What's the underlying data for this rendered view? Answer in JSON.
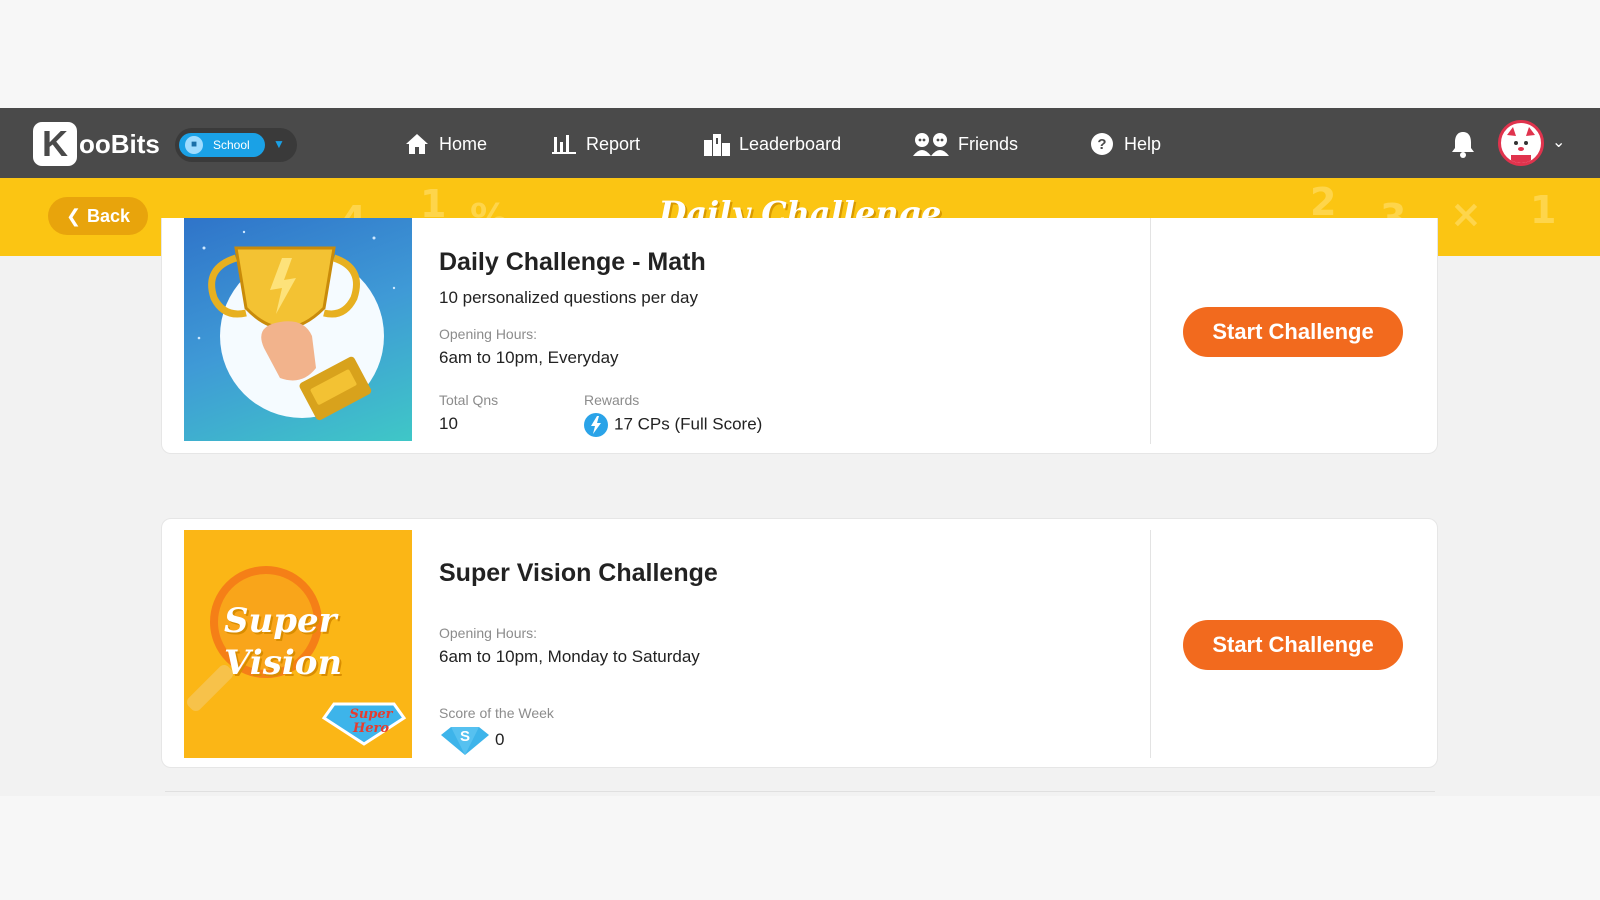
{
  "nav": {
    "logo_k": "K",
    "logo_text": "ooBits",
    "school_label": "School",
    "items": [
      {
        "label": "Home",
        "icon": "home-icon"
      },
      {
        "label": "Report",
        "icon": "bar-chart-icon"
      },
      {
        "label": "Leaderboard",
        "icon": "leaderboard-icon"
      },
      {
        "label": "Friends",
        "icon": "friends-icon"
      },
      {
        "label": "Help",
        "icon": "help-icon"
      }
    ]
  },
  "banner": {
    "back_label": "Back",
    "title": "Daily Challenge"
  },
  "challenges": [
    {
      "title": "Daily Challenge - Math",
      "subtitle": "10 personalized questions per day",
      "hours_label": "Opening Hours:",
      "hours": "6am to 10pm, Everyday",
      "total_label": "Total Qns",
      "total": "10",
      "rewards_label": "Rewards",
      "rewards": "17 CPs (Full Score)",
      "button": "Start Challenge"
    },
    {
      "title": "Super Vision Challenge",
      "thumb_text_1": "Super",
      "thumb_text_2": "Vision",
      "badge_text_1": "Super",
      "badge_text_2": "Hero",
      "hours_label": "Opening Hours:",
      "hours": "6am to 10pm, Monday to Saturday",
      "score_label": "Score of the Week",
      "score_badge": "S",
      "score": "0",
      "button": "Start Challenge"
    }
  ],
  "colors": {
    "nav_bg": "#4a4a4a",
    "banner": "#fbc513",
    "button": "#f26a1e",
    "accent_blue": "#1aa1e6"
  }
}
